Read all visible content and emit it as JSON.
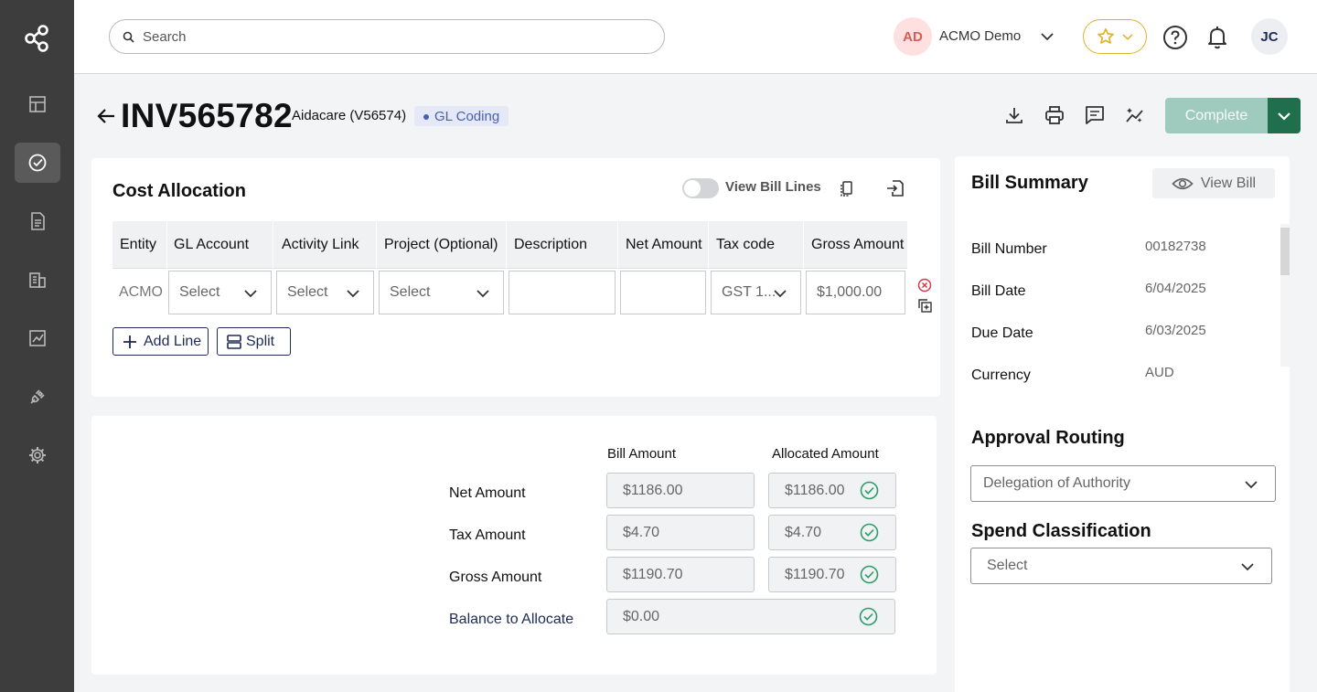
{
  "header": {
    "search_placeholder": "Search",
    "org_initials": "AD",
    "org_name": "ACMO Demo",
    "user_initials": "JC"
  },
  "invoice": {
    "number": "INV565782",
    "vendor": "Aidacare (V56574)",
    "status": "GL Coding",
    "complete_label": "Complete"
  },
  "cost_allocation": {
    "title": "Cost Allocation",
    "view_bill_lines_label": "View Bill Lines",
    "columns": [
      "Entity",
      "GL Account",
      "Activity Link",
      "Project (Optional)",
      "Description",
      "Net Amount",
      "Tax code",
      "Gross Amount"
    ],
    "row": {
      "entity": "ACMO",
      "gl_account": "Select",
      "activity_link": "Select",
      "project": "Select",
      "description": "",
      "net_amount": "",
      "tax_code": "GST 1...",
      "gross_amount": "$1,000.00"
    },
    "add_line_label": "Add Line",
    "split_label": "Split"
  },
  "amounts": {
    "bill_amount_header": "Bill Amount",
    "allocated_amount_header": "Allocated Amount",
    "rows": [
      {
        "label": "Net Amount",
        "bill": "$1186.00",
        "allocated": "$1186.00"
      },
      {
        "label": "Tax Amount",
        "bill": "$4.70",
        "allocated": "$4.70"
      },
      {
        "label": "Gross Amount",
        "bill": "$1190.70",
        "allocated": "$1190.70"
      }
    ],
    "balance": {
      "label": "Balance to Allocate",
      "value": "$0.00"
    }
  },
  "bill_summary": {
    "title": "Bill Summary",
    "view_bill_label": "View Bill",
    "fields": [
      {
        "label": "Bill Number",
        "value": "00182738"
      },
      {
        "label": "Bill Date",
        "value": "6/04/2025"
      },
      {
        "label": "Due Date",
        "value": "6/03/2025"
      },
      {
        "label": "Currency",
        "value": "AUD"
      }
    ],
    "approval_routing": {
      "title": "Approval Routing",
      "value": "Delegation of Authority"
    },
    "spend_classification": {
      "title": "Spend Classification",
      "value": "Select"
    }
  },
  "colors": {
    "sidebar": "#3d3d3d",
    "primary_navy": "#1d2a55",
    "complete_button": "#9fcbbe",
    "complete_dropdown": "#1f6f4d",
    "check_green": "#2e9d6a",
    "favorite_gold": "#e2b22c"
  },
  "icons": {
    "sidebar": [
      "app-logo-icon",
      "dashboard-icon",
      "tasks-check-icon",
      "documents-icon",
      "buildings-icon",
      "reports-chart-icon",
      "integrations-plug-icon",
      "settings-gear-icon"
    ],
    "header_actions": [
      "download-icon",
      "print-icon",
      "comment-icon",
      "sparkle-trend-icon"
    ]
  }
}
